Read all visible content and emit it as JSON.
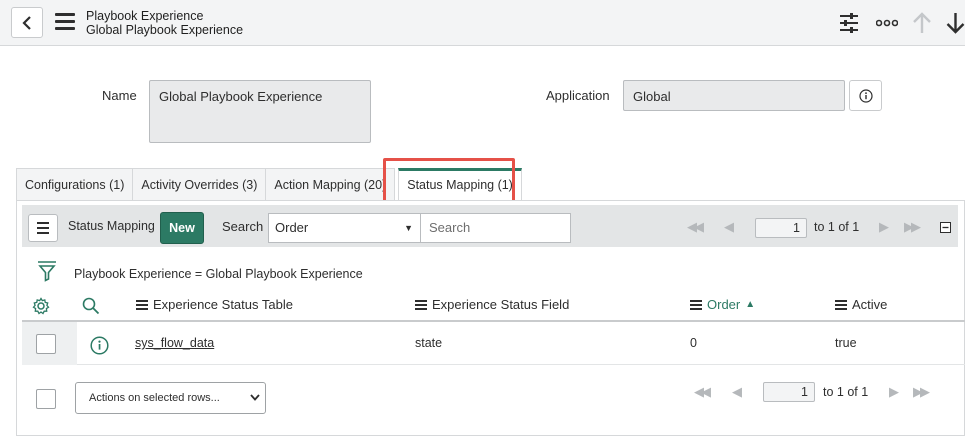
{
  "header": {
    "title": "Playbook Experience",
    "subtitle": "Global Playbook Experience",
    "icons": [
      "chevron-left-icon",
      "hamburger-icon",
      "sliders-icon",
      "more-icon",
      "arrow-up-icon",
      "arrow-down-icon"
    ]
  },
  "form": {
    "name_label": "Name",
    "name_value": "Global Playbook Experience",
    "application_label": "Application",
    "application_value": "Global"
  },
  "tabs": [
    {
      "label": "Configurations (1)"
    },
    {
      "label": "Activity Overrides (3)"
    },
    {
      "label": "Action Mapping (20)"
    },
    {
      "label": "Status Mapping (1)",
      "active": true
    }
  ],
  "list": {
    "title": "Status Mapping",
    "new_label": "New",
    "search_label": "Search",
    "search_field": "Order",
    "search_placeholder": "Search",
    "page": "1",
    "page_of": "to 1 of 1",
    "filter_text": "Playbook Experience = Global Playbook Experience",
    "columns": [
      {
        "label": "Experience Status Table"
      },
      {
        "label": "Experience Status Field"
      },
      {
        "label": "Order",
        "sorted": "ascending"
      },
      {
        "label": "Active"
      }
    ],
    "rows": [
      {
        "table": "sys_flow_data",
        "field": "state",
        "order": "0",
        "active": "true"
      }
    ],
    "actions_label": "Actions on selected rows...",
    "bottom_page": "1",
    "bottom_page_of": "to 1 of 1"
  },
  "colors": {
    "accent": "#2c7a64",
    "highlight": "#e55148",
    "header_bg": "#f3f4f5"
  }
}
